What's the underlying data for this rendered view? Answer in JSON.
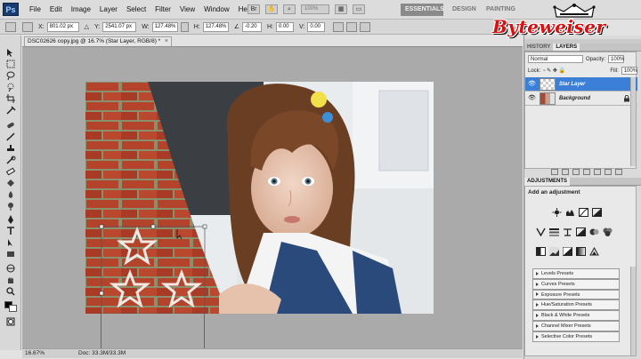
{
  "app": {
    "logo": "Ps"
  },
  "menu": [
    "File",
    "Edit",
    "Image",
    "Layer",
    "Select",
    "Filter",
    "View",
    "Window",
    "Help"
  ],
  "menubar_tools": {
    "zoom_value": "100%",
    "arrange_icon": "arrange-icon",
    "screen_mode_icon": "screen-mode-icon"
  },
  "workspaces": {
    "essentials": "ESSENTIALS",
    "design": "DESIGN",
    "painting": "PAINTING"
  },
  "options": {
    "x_label": "X:",
    "x_value": "801.02 px",
    "y_label": "Y:",
    "y_value": "2541.07 px",
    "w_label": "W:",
    "w_value": "127.48%",
    "h_label": "H:",
    "h_value": "127.48%",
    "angle_value": "-0.20",
    "hskew_label": "H:",
    "hskew_value": "0.00",
    "vskew_label": "V:",
    "vskew_value": "0.00"
  },
  "brand": {
    "text": "Byteweiser"
  },
  "document": {
    "tab_title": "DSC02626 copy.jpg @ 16.7% (Star Layer, RGB/8) *",
    "close": "×"
  },
  "status": {
    "zoom": "16.67%",
    "doc_size": "Doc: 33.3M/33.3M"
  },
  "panels": {
    "top_tabs": [
      "HISTORY",
      "LAYERS"
    ],
    "blend_mode": "Normal",
    "opacity_label": "Opacity:",
    "opacity_value": "100%",
    "lock_label": "Lock:",
    "fill_label": "Fill:",
    "fill_value": "100%",
    "layers": [
      {
        "name": "Star Layer",
        "active": true
      },
      {
        "name": "Background",
        "active": false
      }
    ],
    "adjustments_tab": "ADJUSTMENTS",
    "adjustments_title": "Add an adjustment",
    "presets": [
      "Levels Presets",
      "Curves Presets",
      "Exposure Presets",
      "Hue/Saturation Presets",
      "Black & White Presets",
      "Channel Mixer Presets",
      "Selective Color Presets"
    ]
  },
  "colors": {
    "accent": "#3b7fd7",
    "brand_red": "#d81010",
    "canvas_gray": "#aaaaaa"
  }
}
